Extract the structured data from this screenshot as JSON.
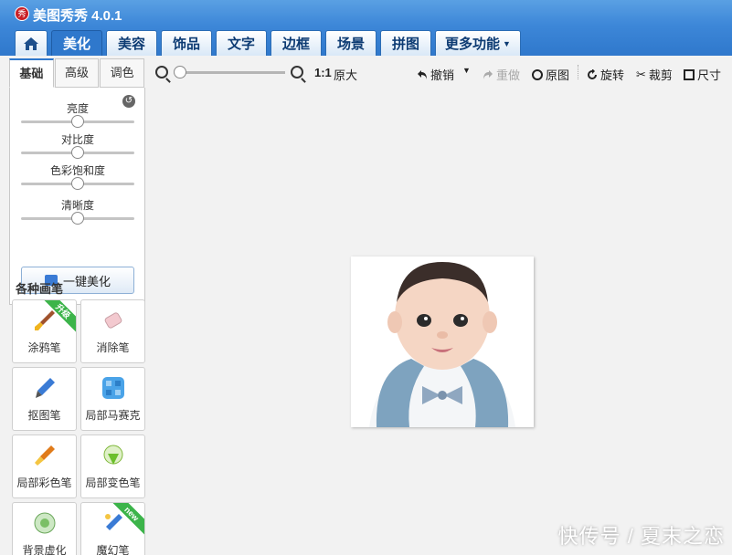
{
  "app": {
    "logo_text": "秀",
    "title": "美图秀秀 4.0.1"
  },
  "tabs": [
    {
      "label": "美化"
    },
    {
      "label": "美容"
    },
    {
      "label": "饰品"
    },
    {
      "label": "文字"
    },
    {
      "label": "边框"
    },
    {
      "label": "场景"
    },
    {
      "label": "拼图"
    },
    {
      "label": "更多功能"
    }
  ],
  "subtabs": [
    "基础",
    "高级",
    "调色"
  ],
  "sliders": [
    {
      "label": "亮度",
      "value": 0.5
    },
    {
      "label": "对比度",
      "value": 0.5
    },
    {
      "label": "色彩饱和度",
      "value": 0.5
    },
    {
      "label": "清晰度",
      "value": 0.5
    }
  ],
  "one_key_label": "一键美化",
  "brushes_title": "各种画笔",
  "brushes": [
    {
      "label": "涂鸦笔",
      "badge": "升级",
      "icon": "paintbrush-icon"
    },
    {
      "label": "消除笔",
      "badge": "",
      "icon": "eraser-icon"
    },
    {
      "label": "抠图笔",
      "badge": "",
      "icon": "cutout-pen-icon"
    },
    {
      "label": "局部马赛克",
      "badge": "",
      "icon": "mosaic-icon"
    },
    {
      "label": "局部彩色笔",
      "badge": "",
      "icon": "color-brush-icon"
    },
    {
      "label": "局部变色笔",
      "badge": "",
      "icon": "recolor-pen-icon"
    },
    {
      "label": "背景虚化",
      "badge": "",
      "icon": "blur-background-icon"
    },
    {
      "label": "魔幻笔",
      "badge": "new",
      "icon": "magic-pen-icon"
    }
  ],
  "toolbar": {
    "ratio": "1:1",
    "orig_size": "原大",
    "undo": "撤销",
    "redo": "重做",
    "original": "原图",
    "rotate": "旋转",
    "crop": "裁剪",
    "size": "尺寸"
  },
  "watermark": "快传号 / 夏末之恋",
  "colors": {
    "accent": "#2f78cc",
    "badge_green": "#3cb44a"
  }
}
